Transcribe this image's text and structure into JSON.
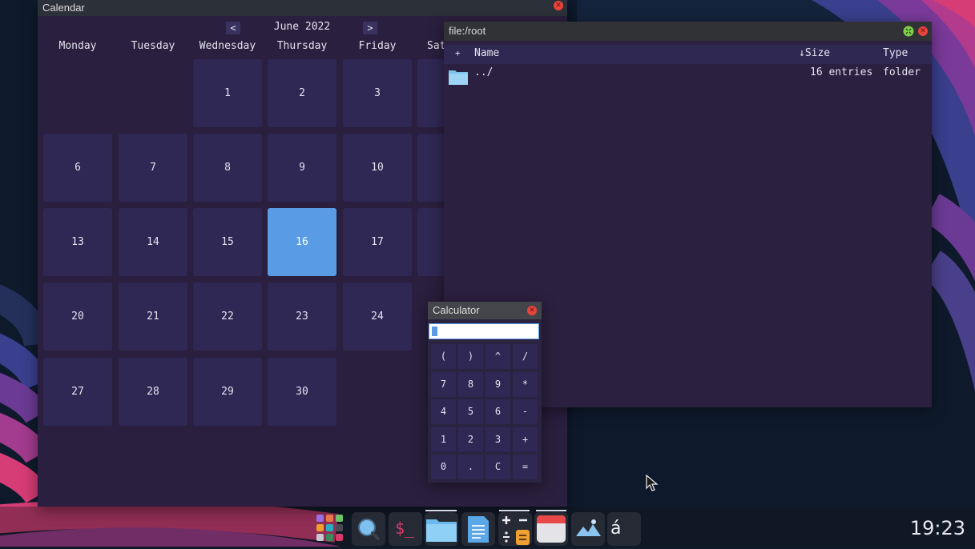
{
  "calendar": {
    "title": "Calendar",
    "prev_label": "<",
    "next_label": ">",
    "month_label": "June 2022",
    "weekdays": [
      "Monday",
      "Tuesday",
      "Wednesday",
      "Thursday",
      "Friday",
      "Sat"
    ],
    "today": "16",
    "weeks": [
      [
        "",
        "",
        "1",
        "2",
        "3",
        ""
      ],
      [
        "6",
        "7",
        "8",
        "9",
        "10",
        ""
      ],
      [
        "13",
        "14",
        "15",
        "16",
        "17",
        ""
      ],
      [
        "20",
        "21",
        "22",
        "23",
        "24",
        ""
      ],
      [
        "27",
        "28",
        "29",
        "30",
        "",
        ""
      ]
    ]
  },
  "file_manager": {
    "title": "file:/root",
    "columns": {
      "add": "+",
      "name": "Name",
      "size": "↓Size",
      "type": "Type"
    },
    "rows": [
      {
        "name": "../",
        "size": "16 entries",
        "type": "folder",
        "icon": "folder-icon"
      }
    ]
  },
  "calculator": {
    "title": "Calculator",
    "display_value": "",
    "keys": [
      [
        "(",
        ")",
        "^",
        "/"
      ],
      [
        "7",
        "8",
        "9",
        "*"
      ],
      [
        "4",
        "5",
        "6",
        "-"
      ],
      [
        "1",
        "2",
        "3",
        "+"
      ],
      [
        "0",
        ".",
        "C",
        "="
      ]
    ]
  },
  "taskbar": {
    "apps": [
      {
        "name": "app-launcher-icon",
        "active": false
      },
      {
        "name": "search-icon",
        "active": false
      },
      {
        "name": "terminal-icon",
        "label": "$_",
        "active": false
      },
      {
        "name": "files-icon",
        "active": true
      },
      {
        "name": "text-editor-icon",
        "active": false
      },
      {
        "name": "calculator-icon",
        "active": true
      },
      {
        "name": "calendar-icon",
        "active": true
      },
      {
        "name": "image-viewer-icon",
        "active": false
      },
      {
        "name": "character-map-icon",
        "label": "á",
        "active": false
      }
    ],
    "clock": "19:23"
  },
  "colors": {
    "accent": "#5a9be6",
    "close": "#e8453c",
    "window_bg": "#2a1f3e",
    "cell_bg": "#2f2855"
  }
}
